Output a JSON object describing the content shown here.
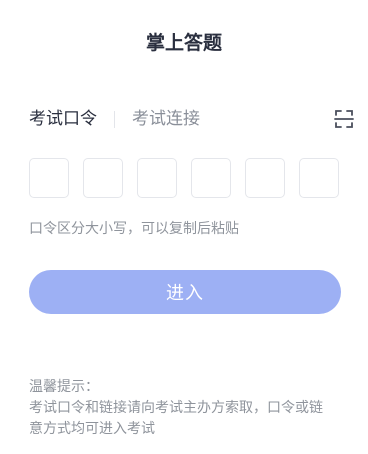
{
  "header": {
    "title": "掌上答题"
  },
  "tabs": [
    {
      "label": "考试口令",
      "active": true
    },
    {
      "label": "考试连接",
      "active": false
    }
  ],
  "scan_icon": "scan-icon",
  "code_inputs": {
    "count": 6,
    "values": [
      "",
      "",
      "",
      "",
      "",
      ""
    ]
  },
  "hint": "口令区分大小写，可以复制后粘贴",
  "enter_button": {
    "label": "进入",
    "color": "#9db0f4"
  },
  "tips": {
    "title": "温馨提示：",
    "line1": "考试口令和链接请向考试主办方索取，口令或链",
    "line2": "意方式均可进入考试"
  }
}
